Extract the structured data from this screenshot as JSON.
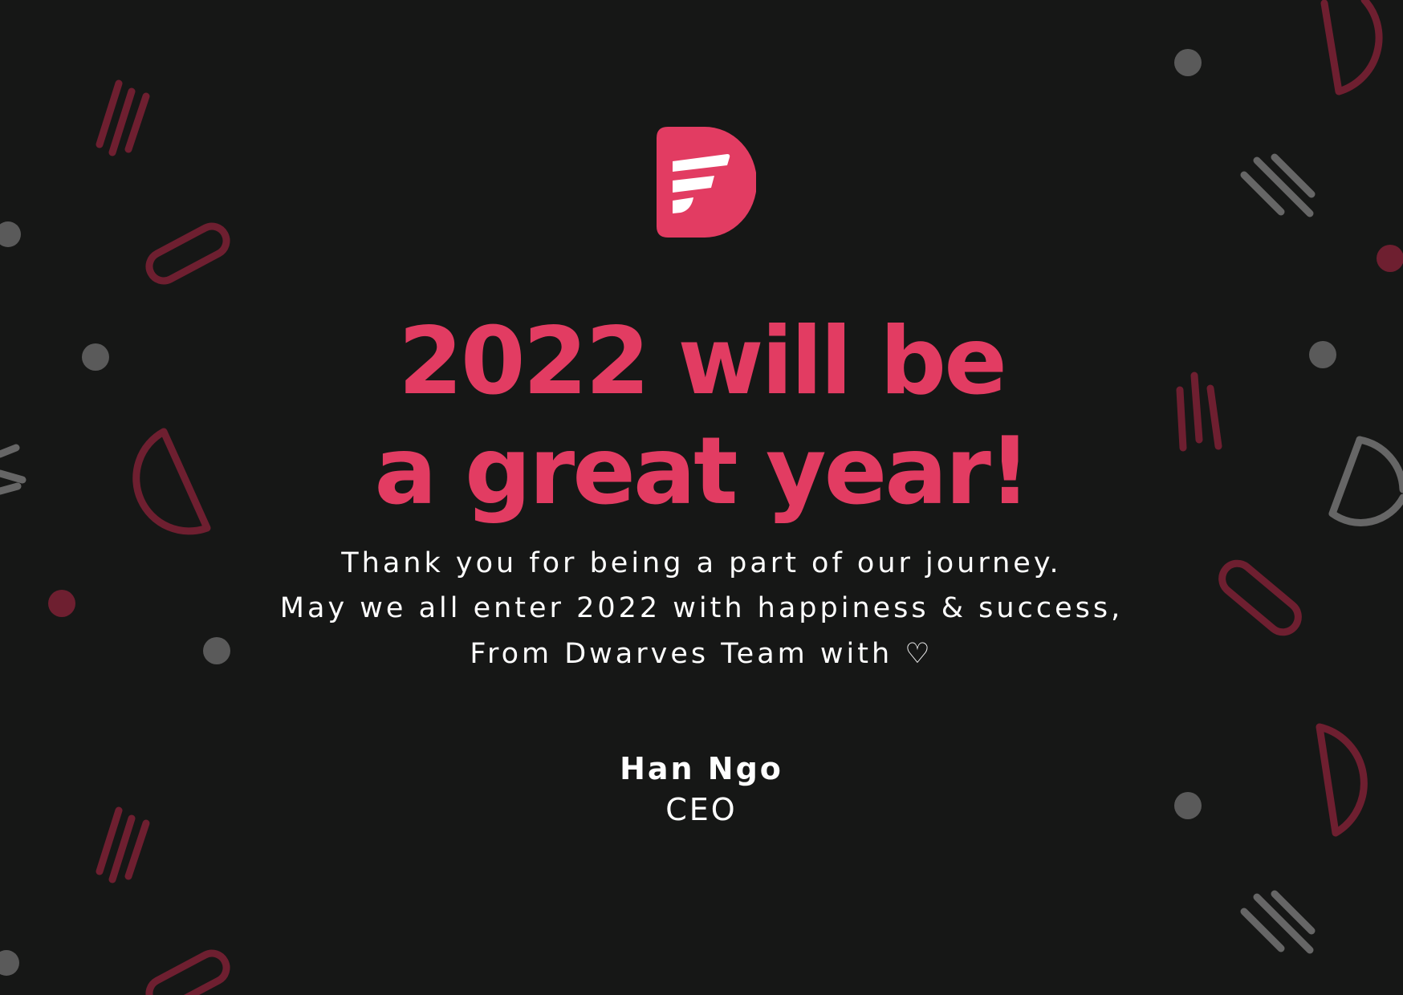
{
  "colors": {
    "background": "#161716",
    "accent": "#e23c62",
    "text": "#ffffff",
    "deco_red": "#6e1f30",
    "deco_gray": "#666666",
    "deco_dot": "#5a5a5a"
  },
  "logo": {
    "icon": "dwarves-d-logo-icon"
  },
  "headline": {
    "line1": "2022 will be",
    "line2": "a great year!"
  },
  "message": {
    "line1": "Thank you for being a part of our journey.",
    "line2": "May we all enter 2022 with happiness & success,",
    "line3": "From Dwarves Team with ♡"
  },
  "signer": {
    "name": "Han Ngo",
    "title": "CEO"
  }
}
